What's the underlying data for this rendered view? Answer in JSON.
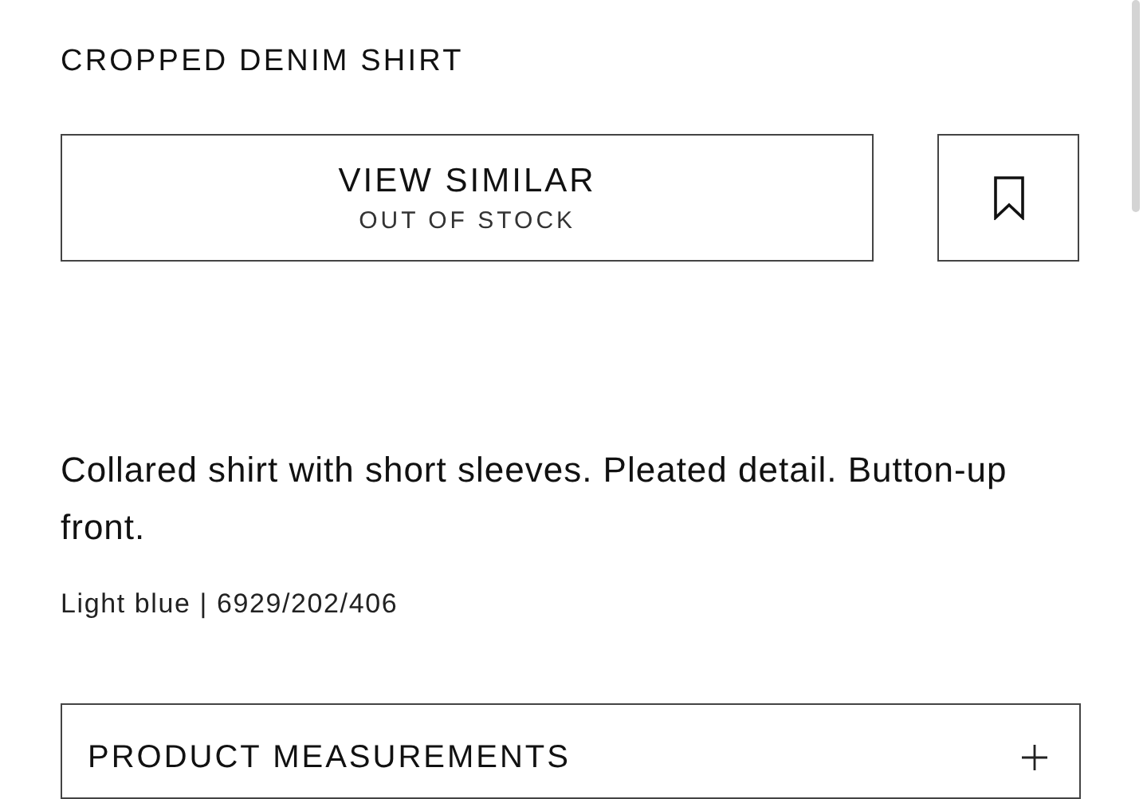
{
  "product": {
    "title": "CROPPED DENIM SHIRT"
  },
  "actions": {
    "primary_label": "VIEW SIMILAR",
    "status": "OUT OF STOCK"
  },
  "description": "Collared shirt with short sleeves. Pleated detail. Button-up front.",
  "color_ref": "Light blue | 6929/202/406",
  "sections": [
    {
      "title": "PRODUCT MEASUREMENTS",
      "expanded": false
    }
  ]
}
